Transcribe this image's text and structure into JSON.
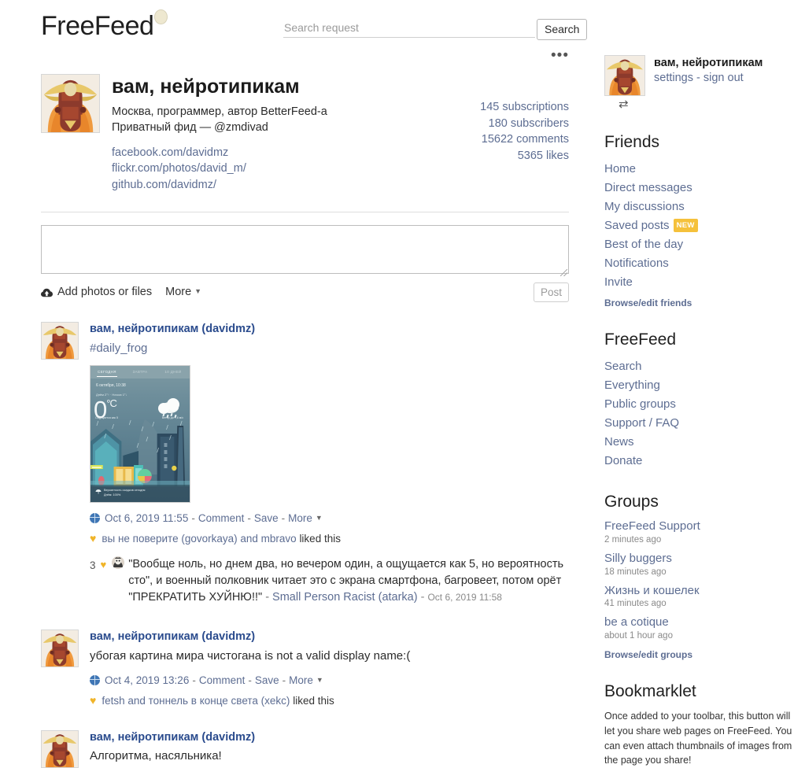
{
  "header": {
    "brand": "FreeFeed",
    "search_placeholder": "Search request",
    "search_value": "",
    "search_button": "Search"
  },
  "profile": {
    "name": "вам, нейротипикам",
    "description_line1": "Москва, программер, автор BetterFeed-a",
    "description_line2": "Приватный фид — @zmdivad",
    "links": [
      "facebook.com/davidmz",
      "flickr.com/photos/david_m/",
      "github.com/davidmz/"
    ],
    "stats": [
      "145 subscriptions",
      "180 subscribers",
      "15622 comments",
      "5365 likes"
    ],
    "more_menu_icon": "ellipsis-icon"
  },
  "composer": {
    "textarea_value": "",
    "textarea_placeholder": "",
    "add_files_label": "Add photos or files",
    "more_label": "More",
    "post_button": "Post"
  },
  "posts": [
    {
      "author": "вам, нейротипикам (davidmz)",
      "text": "#daily_frog",
      "is_tag": true,
      "attachment": {
        "type": "weather-screenshot",
        "tabs": [
          "СЕГОДНЯ",
          "ЗАВТРА",
          "10 ДНЕЙ"
        ],
        "active_tab": 0,
        "date": "6 октября, 10:38",
        "range": "Днём 2°↑ · Ночью 1°↓",
        "temperature": "0",
        "degree": "°C",
        "label_left": "Ощущается как 5",
        "label_right": "Ветер до 7,8 м/с",
        "footer_line1": "Вероятность осадков сегодня",
        "footer_line2": "Днём: 100%"
      },
      "meta": {
        "date": "Oct 6, 2019 11:55",
        "comment": "Comment",
        "save": "Save",
        "more": "More"
      },
      "likes": {
        "names": "вы не поверите (govorkaya) and mbravo",
        "suffix": "liked this"
      },
      "comments": [
        {
          "like_count": "3",
          "body": "\"Вообще ноль, но днем два, но вечером один, а ощущается как 5, но вероятность сто\", и военный полковник читает это с экрана смартфона, багровеет, потом орёт \"ПРЕКРАТИТЬ ХУЙНЮ!!\"",
          "author": "Small Person Racist (atarka)",
          "time": "Oct 6, 2019 11:58"
        }
      ]
    },
    {
      "author": "вам, нейротипикам (davidmz)",
      "text": "убогая картина мира чистогана is not a valid display name:(",
      "is_tag": false,
      "meta": {
        "date": "Oct 4, 2019 13:26",
        "comment": "Comment",
        "save": "Save",
        "more": "More"
      },
      "likes": {
        "names": "fetsh and тоннель в конце света (xekc)",
        "suffix": "liked this"
      },
      "comments": []
    },
    {
      "author": "вам, нейротипикам (davidmz)",
      "text": "Алгоритма, насяльника!",
      "is_tag": false,
      "meta": null,
      "likes": null,
      "comments": []
    }
  ],
  "sidebar": {
    "user": {
      "name": "вам, нейротипикам",
      "settings_label": "settings",
      "separator": "-",
      "signout_label": "sign out",
      "swap_icon": "swap-arrows-icon"
    },
    "friends": {
      "title": "Friends",
      "items": [
        {
          "label": "Home",
          "badge": ""
        },
        {
          "label": "Direct messages",
          "badge": ""
        },
        {
          "label": "My discussions",
          "badge": ""
        },
        {
          "label": "Saved posts",
          "badge": "NEW"
        },
        {
          "label": "Best of the day",
          "badge": ""
        },
        {
          "label": "Notifications",
          "badge": ""
        },
        {
          "label": "Invite",
          "badge": ""
        }
      ],
      "browse_label": "Browse/edit friends"
    },
    "freefeed": {
      "title": "FreeFeed",
      "items": [
        {
          "label": "Search"
        },
        {
          "label": "Everything"
        },
        {
          "label": "Public groups"
        },
        {
          "label": "Support / FAQ"
        },
        {
          "label": "News"
        },
        {
          "label": "Donate"
        }
      ]
    },
    "groups": {
      "title": "Groups",
      "items": [
        {
          "name": "FreeFeed Support",
          "time": "2 minutes ago"
        },
        {
          "name": "Silly buggers",
          "time": "18 minutes ago"
        },
        {
          "name": "Жизнь и кошелек",
          "time": "41 minutes ago"
        },
        {
          "name": "be a cotique",
          "time": "about 1 hour ago"
        }
      ],
      "browse_label": "Browse/edit groups"
    },
    "bookmarklet": {
      "title": "Bookmarklet",
      "text": "Once added to your toolbar, this button will let you share web pages on FreeFeed. You can even attach thumbnails of images from the page you share!"
    }
  },
  "colors": {
    "link": "#5d6d92",
    "author": "#2a4b8d",
    "heart": "#f0b429",
    "badge": "#f5c13b"
  }
}
